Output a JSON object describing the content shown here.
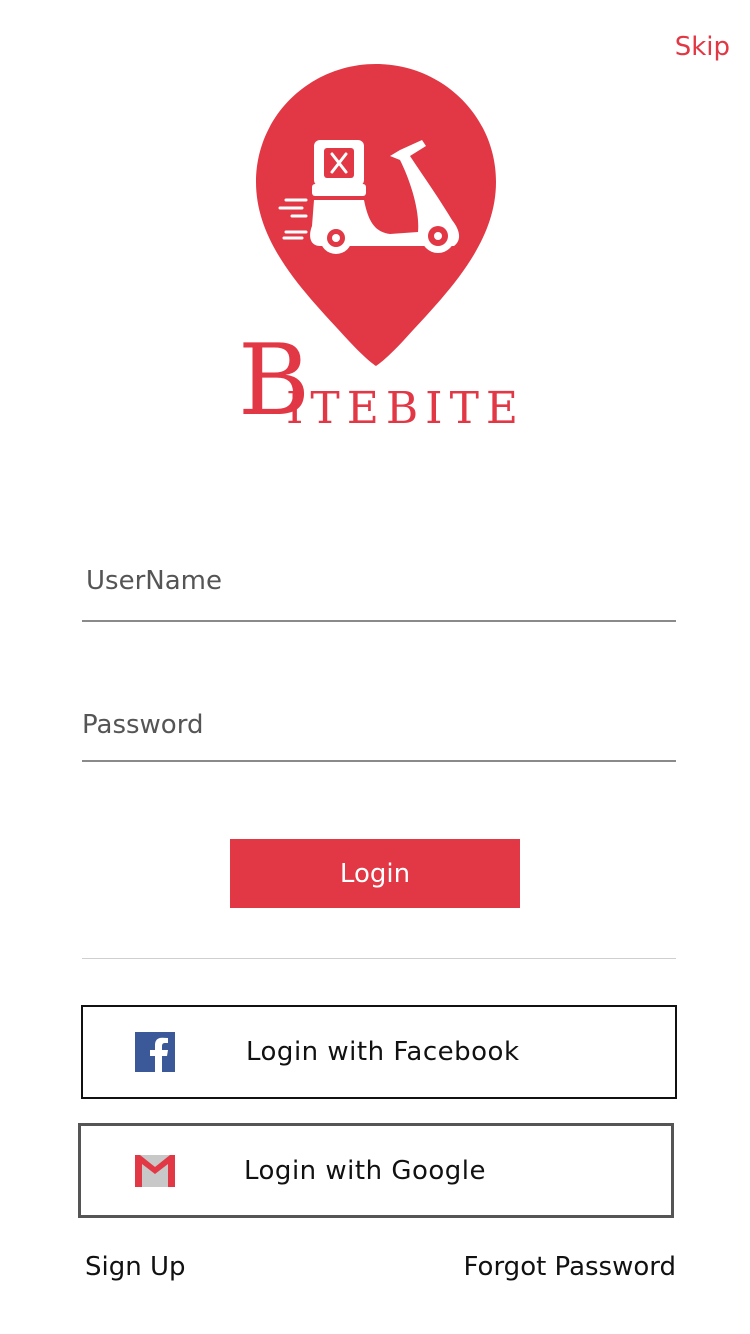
{
  "header": {
    "skip_label": "Skip"
  },
  "brand": {
    "initial": "B",
    "rest": "ITEBITE"
  },
  "colors": {
    "accent": "#e23744",
    "facebook": "#3b5998"
  },
  "form": {
    "username_placeholder": "UserName",
    "password_placeholder": "Password",
    "login_label": "Login"
  },
  "social": {
    "facebook_label": "Login with Facebook",
    "facebook_icon": "facebook-icon",
    "google_label": "Login with Google",
    "google_icon": "gmail-icon"
  },
  "footer": {
    "signup_label": "Sign Up",
    "forgot_label": "Forgot Password"
  }
}
